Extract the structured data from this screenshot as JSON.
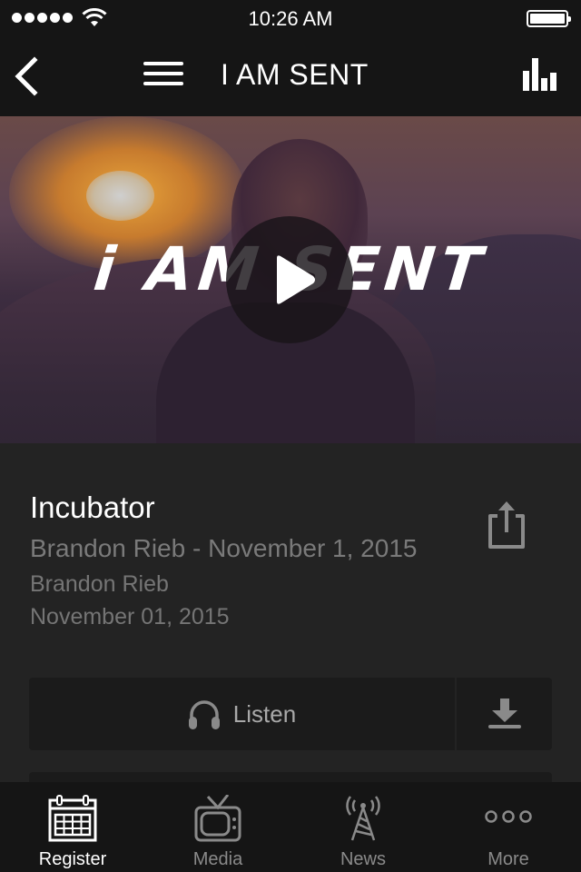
{
  "status_bar": {
    "time": "10:26 AM",
    "signal_bars": 5,
    "battery_percent": 100
  },
  "nav": {
    "title": "I AM SENT",
    "back_icon": "chevron-left-icon",
    "menu_icon": "hamburger-icon",
    "right_icon": "bar-chart-icon"
  },
  "hero": {
    "artwork_text": "i AM SENT",
    "play_icon": "play-icon"
  },
  "media": {
    "title": "Incubator",
    "subtitle": "Brandon Rieb - November 1, 2015",
    "speaker": "Brandon Rieb",
    "date": "November 01, 2015",
    "share_icon": "share-icon"
  },
  "actions": {
    "listen_label": "Listen",
    "listen_icon": "headphones-icon",
    "download_icon": "download-icon"
  },
  "tabs": [
    {
      "label": "Register",
      "icon": "calendar-icon",
      "active": true
    },
    {
      "label": "Media",
      "icon": "tv-icon",
      "active": false
    },
    {
      "label": "News",
      "icon": "broadcast-tower-icon",
      "active": false
    },
    {
      "label": "More",
      "icon": "more-dots-icon",
      "active": false
    }
  ],
  "colors": {
    "bar_background": "#151515",
    "content_background": "#232323",
    "button_background": "#1b1b1b",
    "muted_text": "#7a7a7a",
    "active_tab": "#ffffff",
    "inactive_tab": "#8a8a8a"
  }
}
